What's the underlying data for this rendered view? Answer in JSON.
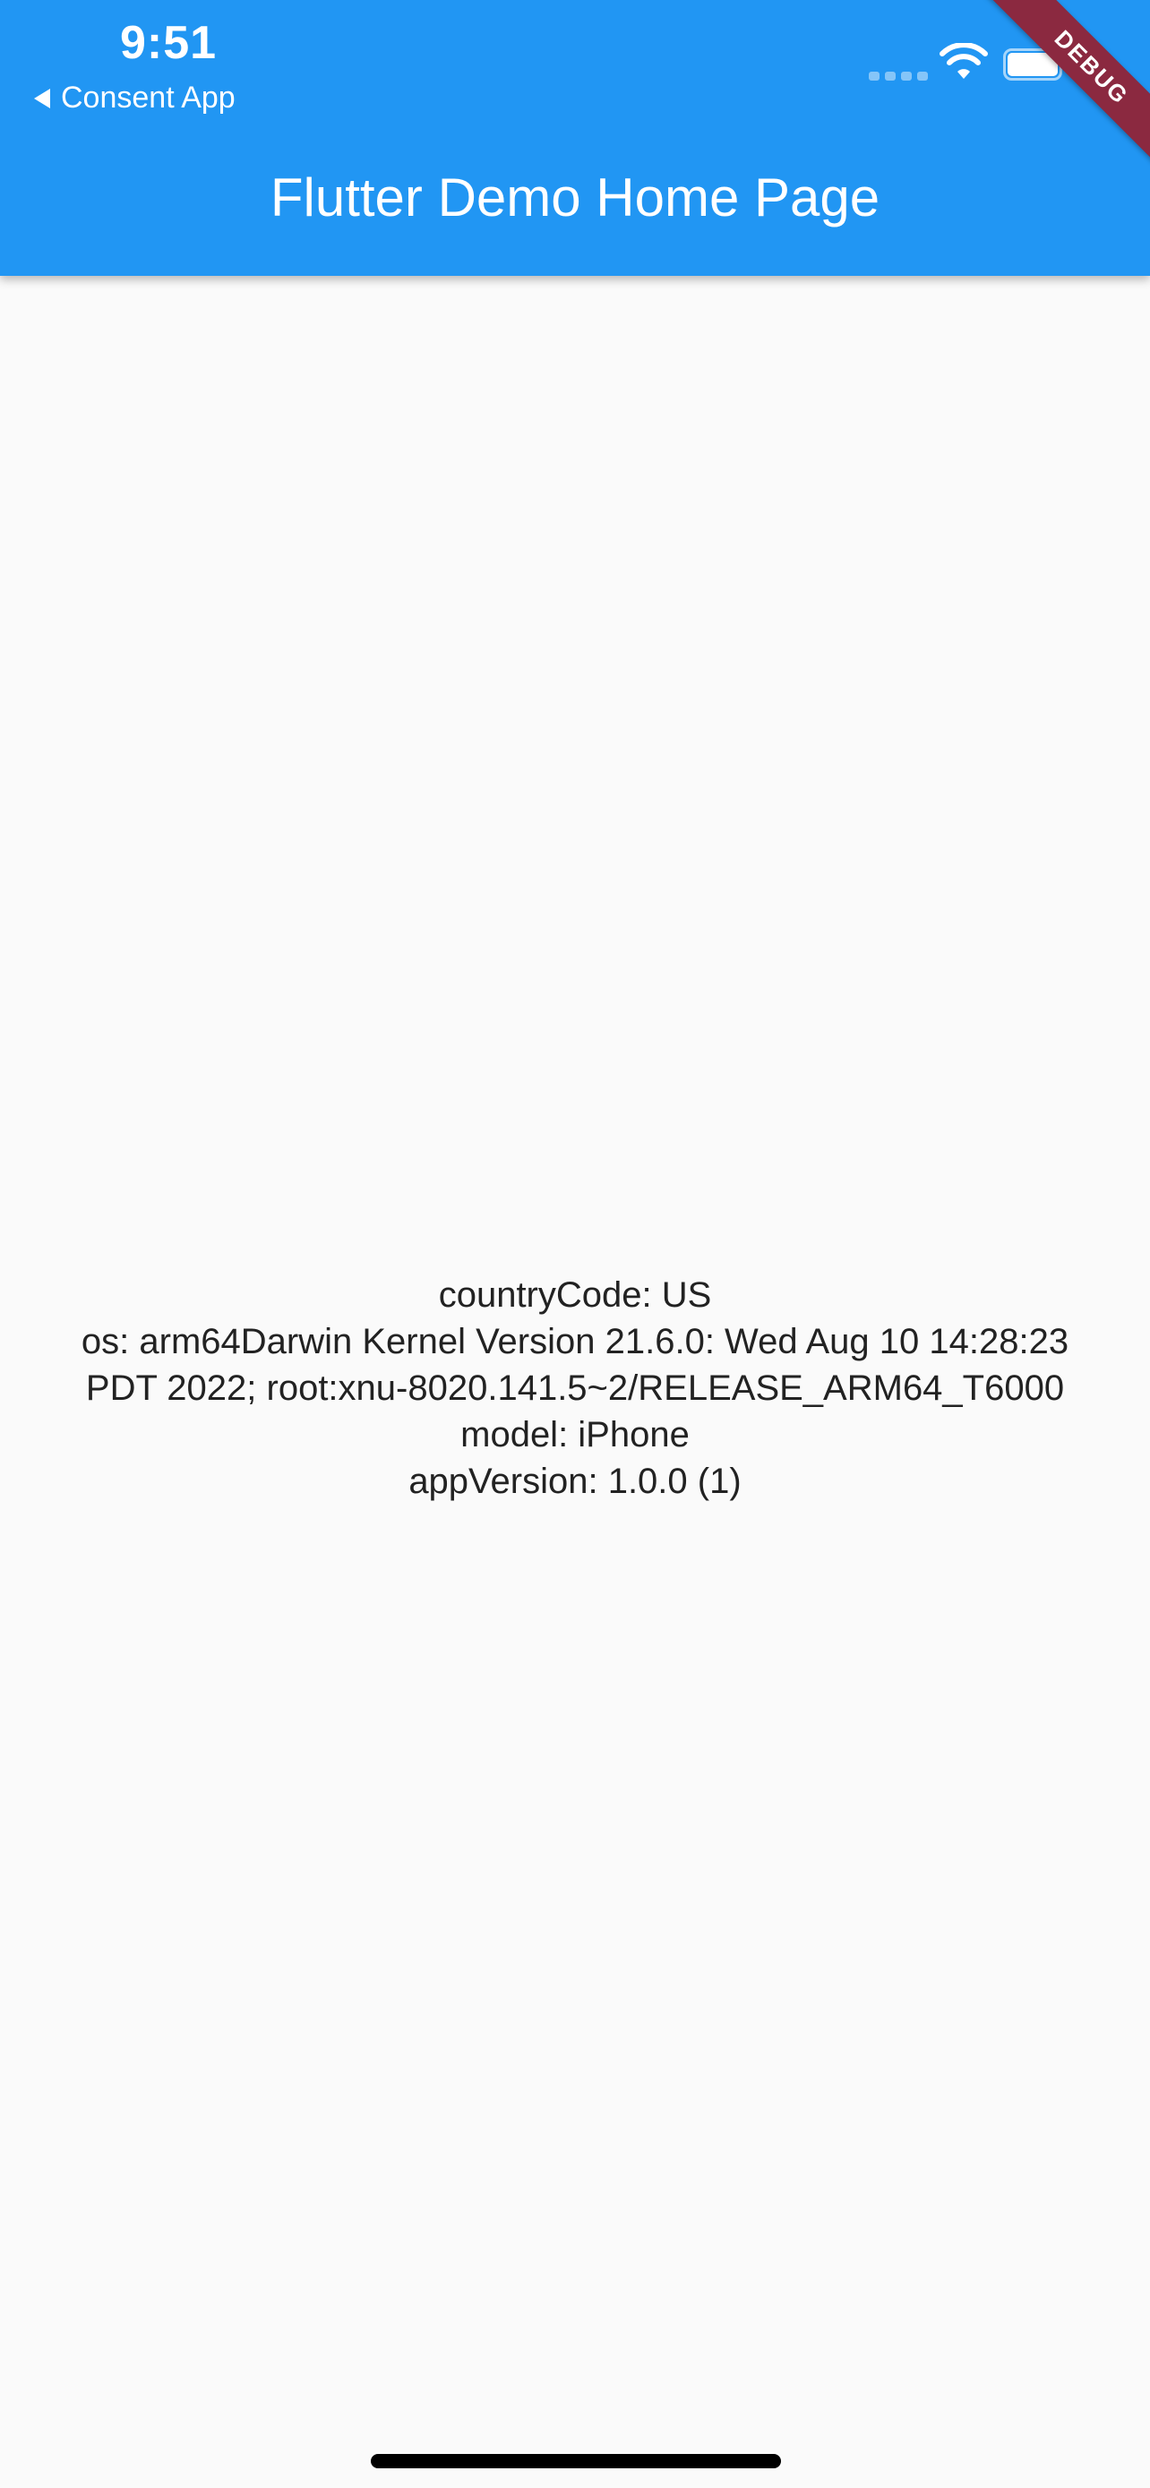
{
  "status_bar": {
    "time": "9:51",
    "back_label": "Consent App",
    "icons": [
      "signal-icon",
      "wifi-icon",
      "battery-icon"
    ]
  },
  "app_bar": {
    "title": "Flutter Demo Home Page",
    "color": "#2196f3"
  },
  "debug_banner": {
    "label": "DEBUG",
    "color": "#8b2940"
  },
  "device_info": {
    "lines": [
      "countryCode:   US",
      "os:   arm64Darwin Kernel Version 21.6.0: Wed Aug 10 14:28:23",
      "PDT 2022; root:xnu-8020.141.5~2/RELEASE_ARM64_T6000",
      "model:   iPhone",
      "appVersion:   1.0.0 (1)"
    ]
  }
}
